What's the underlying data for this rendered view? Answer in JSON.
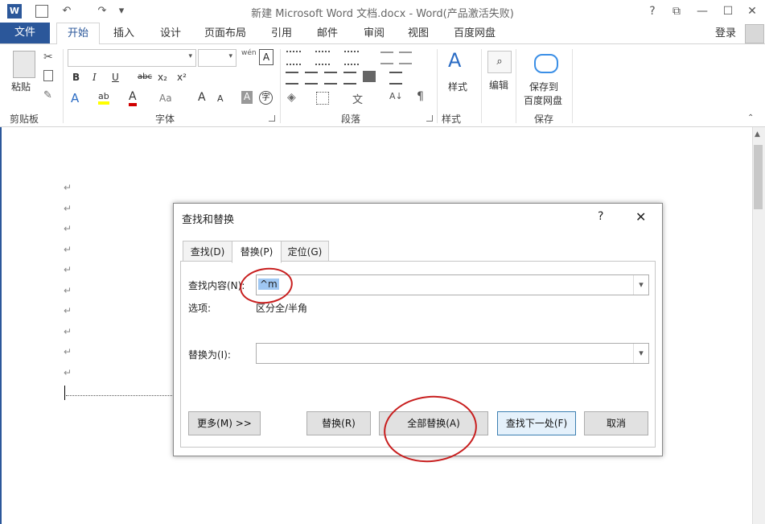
{
  "title_bar": {
    "title": "新建 Microsoft Word 文档.docx - Word(产品激活失败)",
    "quick_access": {
      "undo": "↶",
      "redo": "↷",
      "more": "▾"
    },
    "window_controls": {
      "help": "?",
      "restore": "⧉",
      "minimize": "—",
      "maximize": "☐",
      "close": "✕"
    }
  },
  "tabs": [
    "文件",
    "开始",
    "插入",
    "设计",
    "页面布局",
    "引用",
    "邮件",
    "审阅",
    "视图",
    "百度网盘"
  ],
  "account": {
    "login": "登录"
  },
  "ribbon": {
    "clipboard": {
      "paste": "粘贴",
      "label": "剪贴板"
    },
    "font": {
      "label": "字体",
      "bold": "B",
      "italic": "I",
      "underline": "U",
      "strike": "abc",
      "sub": "x₂",
      "sup": "x²",
      "grow": "A",
      "shrink": "A",
      "aa": "Aa",
      "clear": "A"
    },
    "paragraph": {
      "label": "段落"
    },
    "styles": {
      "label": "样式",
      "button": "样式"
    },
    "editing": {
      "button": "编辑"
    },
    "save": {
      "line1": "保存到",
      "line2": "百度网盘",
      "label": "保存"
    }
  },
  "document": {
    "para_mark": "↵",
    "para_count": 10
  },
  "dialog": {
    "title": "查找和替换",
    "help": "?",
    "close": "✕",
    "tabs": [
      "查找(D)",
      "替换(P)",
      "定位(G)"
    ],
    "find_label": "查找内容(N):",
    "find_value": "^m",
    "options_label": "选项:",
    "options_value": "区分全/半角",
    "replace_label": "替换为(I):",
    "replace_value": "",
    "buttons": {
      "more": "更多(M) >>",
      "replace": "替换(R)",
      "replace_all": "全部替换(A)",
      "find_next": "查找下一处(F)",
      "cancel": "取消"
    }
  },
  "colors": {
    "accent": "#2b579a",
    "annotation": "#c81e1e"
  }
}
